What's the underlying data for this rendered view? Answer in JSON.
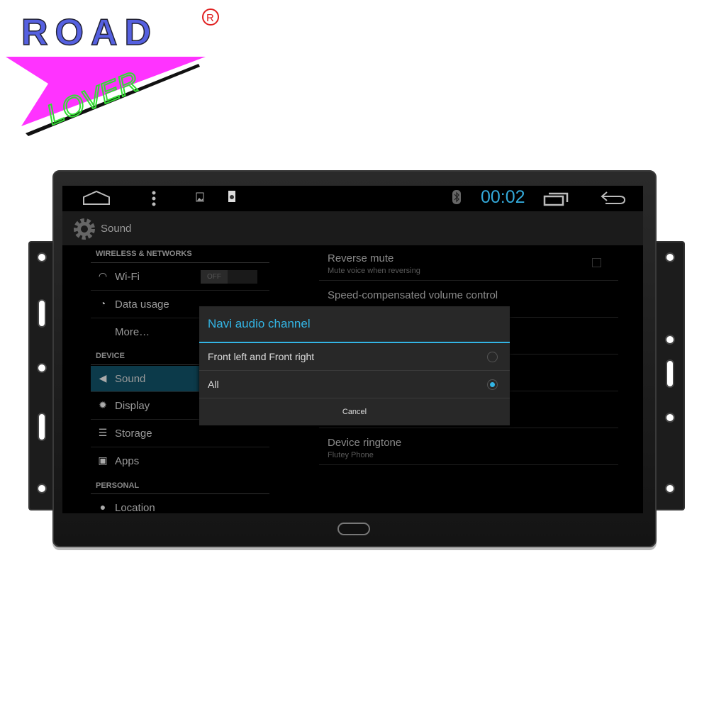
{
  "brand": {
    "word1": "ROAD",
    "word2": "LOVER",
    "registered": "®",
    "colors": {
      "road": "#5560e0",
      "banner": "#ff33ff",
      "lover": "#33dd33"
    }
  },
  "statusbar": {
    "clock": "00:02",
    "icons": [
      "home-icon",
      "menu-dots-icon",
      "image-icon",
      "sd-card-icon",
      "bluetooth-icon",
      "recent-apps-icon",
      "back-icon"
    ],
    "accent": "#33a8d8"
  },
  "actionbar": {
    "title": "Sound",
    "icon": "gear-icon"
  },
  "sidebar": {
    "headers": [
      "WIRELESS & NETWORKS",
      "DEVICE",
      "PERSONAL"
    ],
    "items": [
      {
        "label": "Wi-Fi",
        "icon": "wifi-icon",
        "toggle": "OFF"
      },
      {
        "label": "Data usage",
        "icon": "data-usage-icon"
      },
      {
        "label": "More…",
        "icon": ""
      },
      {
        "label": "Sound",
        "icon": "speaker-icon",
        "selected": true
      },
      {
        "label": "Display",
        "icon": "display-icon"
      },
      {
        "label": "Storage",
        "icon": "storage-icon"
      },
      {
        "label": "Apps",
        "icon": "apps-icon"
      },
      {
        "label": "Location",
        "icon": "location-icon"
      }
    ]
  },
  "settings": [
    {
      "title": "Reverse mute",
      "subtitle": "Mute voice when reversing",
      "checked": false
    },
    {
      "title": "Speed-compensated volume control",
      "subtitle": ""
    },
    {
      "title": "Device ringtone",
      "subtitle": "Flutey Phone"
    }
  ],
  "dialog": {
    "title": "Navi audio channel",
    "options": [
      {
        "label": "Front left and Front right",
        "selected": false
      },
      {
        "label": "All",
        "selected": true
      }
    ],
    "cancel": "Cancel"
  }
}
